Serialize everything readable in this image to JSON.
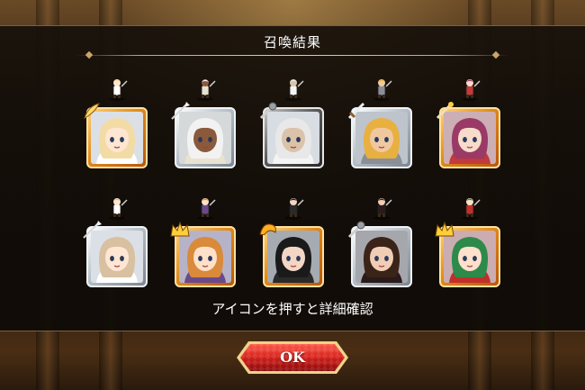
{
  "screen": {
    "title": "召喚結果",
    "hint": "アイコンを押すと詳細確認",
    "ok_label": "OK"
  },
  "results": [
    {
      "rarity": "gold",
      "hair": "#f3dba6",
      "skin": "#ffe6d2",
      "outfit": "#ffffff",
      "badge": "feather"
    },
    {
      "rarity": "silver",
      "hair": "#f2f2f2",
      "skin": "#8b5a3c",
      "outfit": "#e9e2d0",
      "badge": "spear"
    },
    {
      "rarity": "black",
      "hair": "#e8e8e8",
      "skin": "#dac3a8",
      "outfit": "#f4f4f4",
      "badge": "mace"
    },
    {
      "rarity": "silver",
      "hair": "#e8b040",
      "skin": "#f0c8a0",
      "outfit": "#8a8f96",
      "badge": "sword"
    },
    {
      "rarity": "gold",
      "hair": "#9a3a66",
      "skin": "#f7dccb",
      "outfit": "#c23a3a",
      "badge": "staff"
    },
    {
      "rarity": "silver",
      "hair": "#d8c0a0",
      "skin": "#ffe6d2",
      "outfit": "#ffffff",
      "badge": "spear"
    },
    {
      "rarity": "gold",
      "hair": "#d98a3a",
      "skin": "#ffe0c8",
      "outfit": "#6a4a8a",
      "badge": "crown"
    },
    {
      "rarity": "gold",
      "hair": "#1a1a1a",
      "skin": "#f4d6c4",
      "outfit": "#2a2a2a",
      "badge": "dragon"
    },
    {
      "rarity": "silver",
      "hair": "#3a2418",
      "skin": "#f0cdb4",
      "outfit": "#2a1a1a",
      "badge": "mace"
    },
    {
      "rarity": "gold",
      "hair": "#2d8a4a",
      "skin": "#ffe0cc",
      "outfit": "#c0302a",
      "badge": "crown"
    }
  ]
}
